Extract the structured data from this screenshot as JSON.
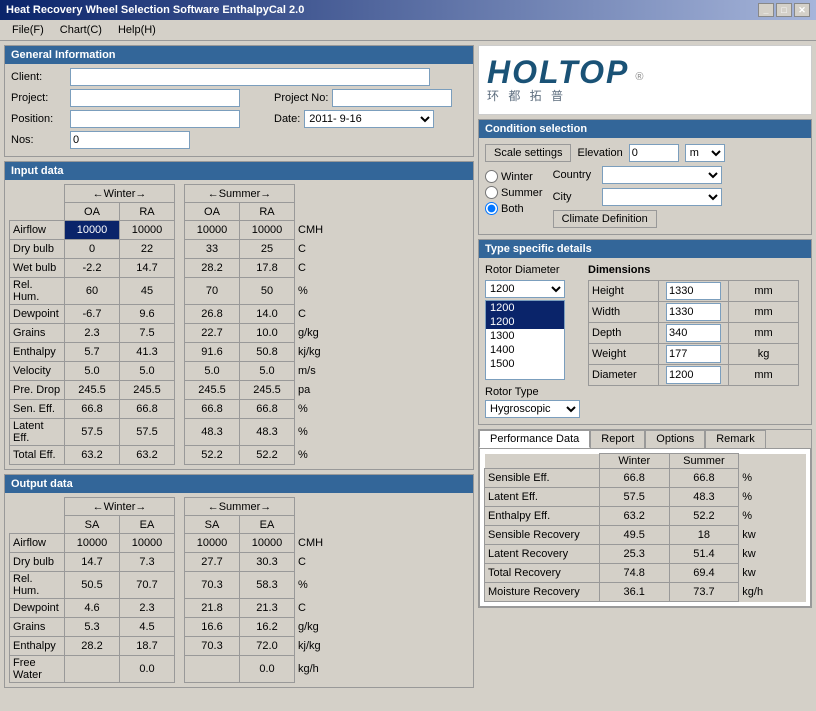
{
  "window": {
    "title": "Heat Recovery Wheel Selection Software EnthalpyCal 2.0"
  },
  "menu": {
    "items": [
      "File(F)",
      "Chart(C)",
      "Help(H)"
    ]
  },
  "general_info": {
    "title": "General Information",
    "client_label": "Client:",
    "project_label": "Project:",
    "project_no_label": "Project No:",
    "position_label": "Position:",
    "date_label": "Date:",
    "nos_label": "Nos:",
    "nos_value": "0",
    "date_value": "2011- 9-16",
    "client_value": "",
    "project_value": "",
    "project_no_value": "",
    "position_value": ""
  },
  "input_data": {
    "title": "Input data",
    "winter_label": "Winter",
    "summer_label": "Summer",
    "oa_label": "OA",
    "ra_label": "RA",
    "rows": [
      {
        "label": "Airflow",
        "w_oa": "10000",
        "w_ra": "10000",
        "s_oa": "10000",
        "s_ra": "10000",
        "unit": "CMH",
        "highlight_w_oa": true
      },
      {
        "label": "Dry bulb",
        "w_oa": "0",
        "w_ra": "22",
        "s_oa": "33",
        "s_ra": "25",
        "unit": "C"
      },
      {
        "label": "Wet bulb",
        "w_oa": "-2.2",
        "w_ra": "14.7",
        "s_oa": "28.2",
        "s_ra": "17.8",
        "unit": "C"
      },
      {
        "label": "Rel. Hum.",
        "w_oa": "60",
        "w_ra": "45",
        "s_oa": "70",
        "s_ra": "50",
        "unit": "%"
      },
      {
        "label": "Dewpoint",
        "w_oa": "-6.7",
        "w_ra": "9.6",
        "s_oa": "26.8",
        "s_ra": "14.0",
        "unit": "C"
      },
      {
        "label": "Grains",
        "w_oa": "2.3",
        "w_ra": "7.5",
        "s_oa": "22.7",
        "s_ra": "10.0",
        "unit": "g/kg"
      },
      {
        "label": "Enthalpy",
        "w_oa": "5.7",
        "w_ra": "41.3",
        "s_oa": "91.6",
        "s_ra": "50.8",
        "unit": "kj/kg"
      },
      {
        "label": "Velocity",
        "w_oa": "5.0",
        "w_ra": "5.0",
        "s_oa": "5.0",
        "s_ra": "5.0",
        "unit": "m/s"
      },
      {
        "label": "Pre. Drop",
        "w_oa": "245.5",
        "w_ra": "245.5",
        "s_oa": "245.5",
        "s_ra": "245.5",
        "unit": "pa"
      },
      {
        "label": "Sen. Eff.",
        "w_oa": "66.8",
        "w_ra": "66.8",
        "s_oa": "66.8",
        "s_ra": "66.8",
        "unit": "%"
      },
      {
        "label": "Latent Eff.",
        "w_oa": "57.5",
        "w_ra": "57.5",
        "s_oa": "48.3",
        "s_ra": "48.3",
        "unit": "%"
      },
      {
        "label": "Total Eff.",
        "w_oa": "63.2",
        "w_ra": "63.2",
        "s_oa": "52.2",
        "s_ra": "52.2",
        "unit": "%"
      }
    ]
  },
  "output_data": {
    "title": "Output data",
    "winter_label": "Winter",
    "summer_label": "Summer",
    "sa_label": "SA",
    "ea_label": "EA",
    "rows": [
      {
        "label": "Airflow",
        "w_sa": "10000",
        "w_ea": "10000",
        "s_sa": "10000",
        "s_ea": "10000",
        "unit": "CMH"
      },
      {
        "label": "Dry bulb",
        "w_sa": "14.7",
        "w_ea": "7.3",
        "s_sa": "27.7",
        "s_ea": "30.3",
        "unit": "C"
      },
      {
        "label": "Rel. Hum.",
        "w_sa": "50.5",
        "w_ea": "70.7",
        "s_sa": "70.3",
        "s_ea": "58.3",
        "unit": "%"
      },
      {
        "label": "Dewpoint",
        "w_sa": "4.6",
        "w_ea": "2.3",
        "s_sa": "21.8",
        "s_ea": "21.3",
        "unit": "C"
      },
      {
        "label": "Grains",
        "w_sa": "5.3",
        "w_ea": "4.5",
        "s_sa": "16.6",
        "s_ea": "16.2",
        "unit": "g/kg"
      },
      {
        "label": "Enthalpy",
        "w_sa": "28.2",
        "w_ea": "18.7",
        "s_sa": "70.3",
        "s_ea": "72.0",
        "unit": "kj/kg"
      },
      {
        "label": "Free Water",
        "w_sa": "",
        "w_ea": "0.0",
        "s_sa": "",
        "s_ea": "0.0",
        "unit": "kg/h"
      }
    ]
  },
  "logo": {
    "holtop": "HOLTOP",
    "chinese": "环 都 拓 普"
  },
  "condition_selection": {
    "title": "Condition selection",
    "scale_settings_label": "Scale settings",
    "elevation_label": "Elevation",
    "elevation_value": "0",
    "elevation_unit": "m",
    "country_label": "Country",
    "city_label": "City",
    "winter_label": "Winter",
    "summer_label": "Summer",
    "both_label": "Both",
    "climate_def_label": "Climate Definition",
    "selected_season": "both"
  },
  "type_details": {
    "title": "Type specific details",
    "rotor_diameter_label": "Rotor Diameter",
    "diameters": [
      "1200",
      "1200",
      "1300",
      "1400",
      "1500"
    ],
    "selected_diameter": "1200",
    "dimensions_label": "Dimensions",
    "height_label": "Height",
    "height_value": "1330",
    "height_unit": "mm",
    "width_label": "Width",
    "width_value": "1330",
    "width_unit": "mm",
    "depth_label": "Depth",
    "depth_value": "340",
    "depth_unit": "mm",
    "weight_label": "Weight",
    "weight_value": "177",
    "weight_unit": "kg",
    "diameter_label": "Diameter",
    "diameter_value": "1200",
    "diameter_unit": "mm",
    "rotor_type_label": "Rotor Type",
    "rotor_type_value": "Hygroscopic"
  },
  "performance": {
    "tabs": [
      "Performance Data",
      "Report",
      "Options",
      "Remark"
    ],
    "active_tab": "Performance Data",
    "winter_label": "Winter",
    "summer_label": "Summer",
    "rows": [
      {
        "label": "Sensible Eff.",
        "winter": "66.8",
        "summer": "66.8",
        "unit": "%"
      },
      {
        "label": "Latent Eff.",
        "winter": "57.5",
        "summer": "48.3",
        "unit": "%"
      },
      {
        "label": "Enthalpy Eff.",
        "winter": "63.2",
        "summer": "52.2",
        "unit": "%"
      },
      {
        "label": "Sensible Recovery",
        "winter": "49.5",
        "summer": "18",
        "unit": "kw"
      },
      {
        "label": "Latent Recovery",
        "winter": "25.3",
        "summer": "51.4",
        "unit": "kw"
      },
      {
        "label": "Total Recovery",
        "winter": "74.8",
        "summer": "69.4",
        "unit": "kw"
      },
      {
        "label": "Moisture Recovery",
        "winter": "36.1",
        "summer": "73.7",
        "unit": "kg/h"
      }
    ]
  }
}
